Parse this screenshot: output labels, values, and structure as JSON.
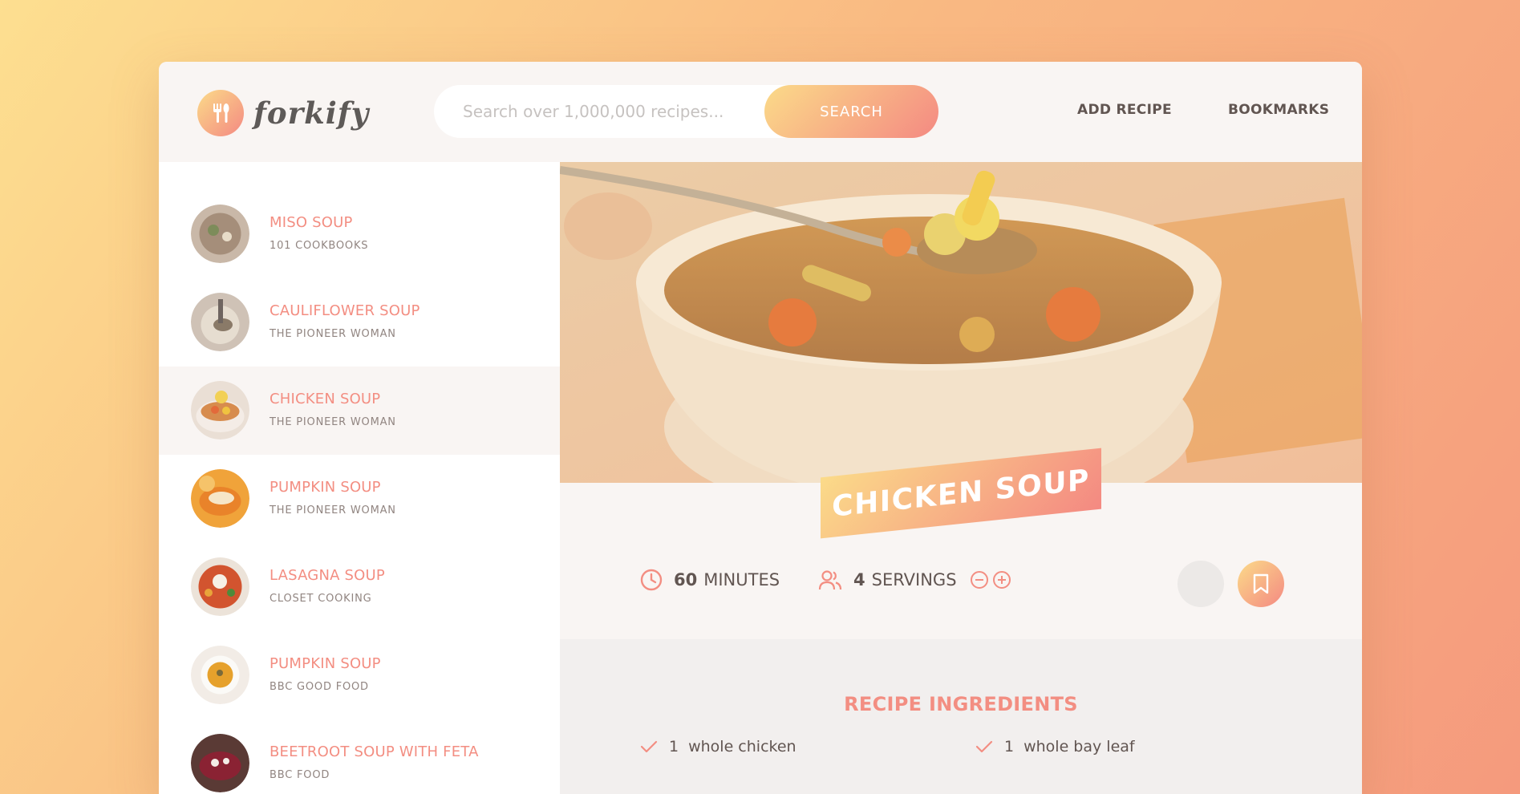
{
  "app": {
    "logo_text": "forkify"
  },
  "search": {
    "placeholder": "Search over 1,000,000 recipes...",
    "button_label": "SEARCH"
  },
  "nav": {
    "add_recipe": "ADD RECIPE",
    "bookmarks": "BOOKMARKS"
  },
  "results": [
    {
      "title": "MISO SOUP",
      "publisher": "101 COOKBOOKS"
    },
    {
      "title": "CAULIFLOWER SOUP",
      "publisher": "THE PIONEER WOMAN"
    },
    {
      "title": "CHICKEN SOUP",
      "publisher": "THE PIONEER WOMAN"
    },
    {
      "title": "PUMPKIN SOUP",
      "publisher": "THE PIONEER WOMAN"
    },
    {
      "title": "LASAGNA SOUP",
      "publisher": "CLOSET COOKING"
    },
    {
      "title": "PUMPKIN SOUP",
      "publisher": "BBC GOOD FOOD"
    },
    {
      "title": "BEETROOT SOUP WITH FETA",
      "publisher": "BBC FOOD"
    }
  ],
  "recipe": {
    "title": "CHICKEN SOUP",
    "cooking_time": "60",
    "cooking_time_unit": "MINUTES",
    "servings": "4",
    "servings_unit": "SERVINGS",
    "ingredients_heading": "RECIPE INGREDIENTS",
    "ingredients": [
      {
        "qty": "1",
        "desc": "whole chicken"
      },
      {
        "qty": "1",
        "desc": "whole bay leaf"
      }
    ]
  },
  "colors": {
    "accent": "#f38e82",
    "gradient_start": "#fbdb89",
    "gradient_end": "#f48982",
    "text": "#615551"
  },
  "icons": [
    "fork-spoon-icon",
    "clock-icon",
    "users-icon",
    "minus-circle-icon",
    "plus-circle-icon",
    "bookmark-icon",
    "check-icon"
  ]
}
